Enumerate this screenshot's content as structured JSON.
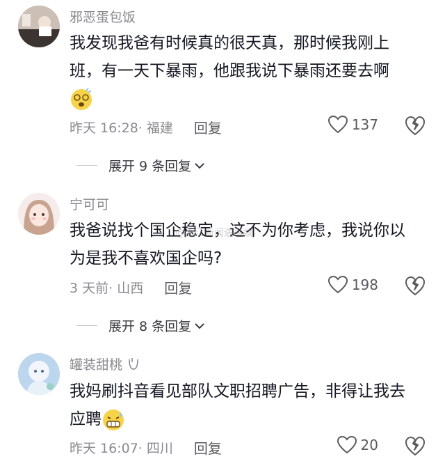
{
  "comments": [
    {
      "username": "邪恶蛋包饭",
      "text_line1": "我发现我爸有时候真的很天真，那时候我刚上",
      "text_line2": "班，有一天下暴雨，他跟我说下暴雨还要去啊",
      "emoji_icon": "dizzy-face-emoji",
      "time": "昨天 16:28",
      "location": "· 福建",
      "reply_label": "回复",
      "likes": "137",
      "expand_label": "展开 9 条回复"
    },
    {
      "username": "宁可可",
      "text_line1": "我爸说找个国企稳定，这不为你考虑，我说你以",
      "text_line2": "为是我不喜欢国企吗?",
      "time": "3 天前",
      "location": "· 山西",
      "reply_label": "回复",
      "likes": "198",
      "expand_label": "展开 8 条回复"
    },
    {
      "username": "罐装甜桃",
      "text_line1": "我妈刷抖音看见部队文职招聘广告，非得让我去",
      "text_line2": "应聘",
      "emoji_icon": "grimacing-sweat-emoji",
      "time": "昨天 16:07",
      "location": "· 四川",
      "reply_label": "回复",
      "likes": "20"
    }
  ],
  "watermark": "@浙江新闻遇事娱"
}
